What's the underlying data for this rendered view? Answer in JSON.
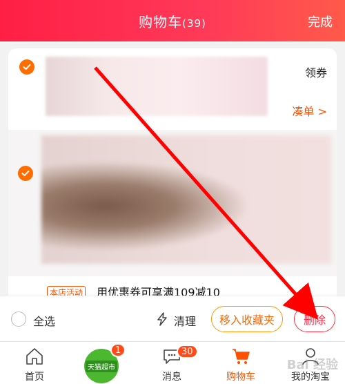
{
  "header": {
    "title": "购物车",
    "count": "(39)",
    "done_label": "完成"
  },
  "shop_card": {
    "coupon_label": "领券",
    "combine_label": "凑单 >"
  },
  "item_card": {},
  "promo": {
    "tag": "本店活动",
    "text": "用优惠券可享满109减10"
  },
  "footer": {
    "select_all": "全选",
    "clean_label": "清理",
    "favorite_label": "移入收藏夹",
    "delete_label": "删除"
  },
  "tabbar": {
    "items": [
      {
        "label": "首页",
        "icon": "home-icon"
      },
      {
        "label": "",
        "icon": "tmall-supermarket-icon",
        "tmall_text": "天猫超市",
        "badge": "1"
      },
      {
        "label": "消息",
        "icon": "message-icon",
        "badge": "30"
      },
      {
        "label": "购物车",
        "icon": "cart-icon"
      },
      {
        "label": "我的淘宝",
        "icon": "profile-icon"
      }
    ]
  },
  "watermark": "Bai 经验",
  "colors": {
    "accent": "#ff5000",
    "header": "#ff2a4a",
    "annotation_arrow": "#ff0000"
  }
}
